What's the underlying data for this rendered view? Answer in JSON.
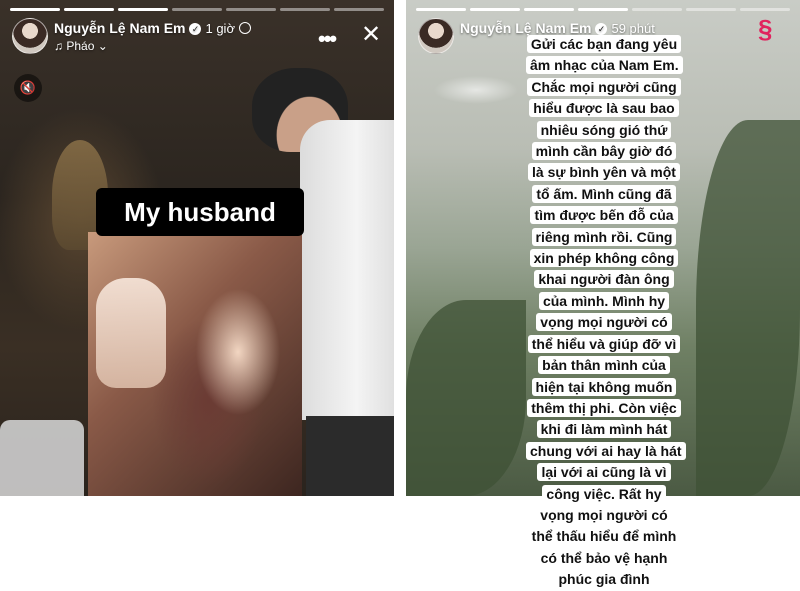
{
  "left_story": {
    "username": "Nguyễn Lệ Nam Em",
    "time": "1 giờ",
    "music": "Pháo",
    "caption": "My husband",
    "icons": [
      "verified-icon",
      "globe-icon",
      "music-note-icon",
      "chevron-down-icon",
      "more-icon",
      "close-icon",
      "mute-icon"
    ]
  },
  "right_story": {
    "username": "Nguyễn Lệ Nam Em",
    "time": "59 phút",
    "message": "Gửi các bạn đang yêu âm nhạc của Nam Em. Chắc mọi người cũng hiểu được là sau bao nhiêu sóng gió thứ mình cần bây giờ đó là sự bình yên và một tổ ấm. Mình cũng đã tìm được bến đỗ của riêng mình rồi. Cũng xin phép không công khai người đàn ông của mình. Mình hy vọng mọi người có thể hiểu và giúp đỡ vì bản thân mình của hiện tại không muốn thêm thị phi. Còn việc khi đi làm mình hát chung với ai hay là hát lại với ai cũng là vì công việc. Rất hy vọng mọi người có thể thấu hiểu để mình có thể bảo vệ hạnh phúc gia đình"
  }
}
